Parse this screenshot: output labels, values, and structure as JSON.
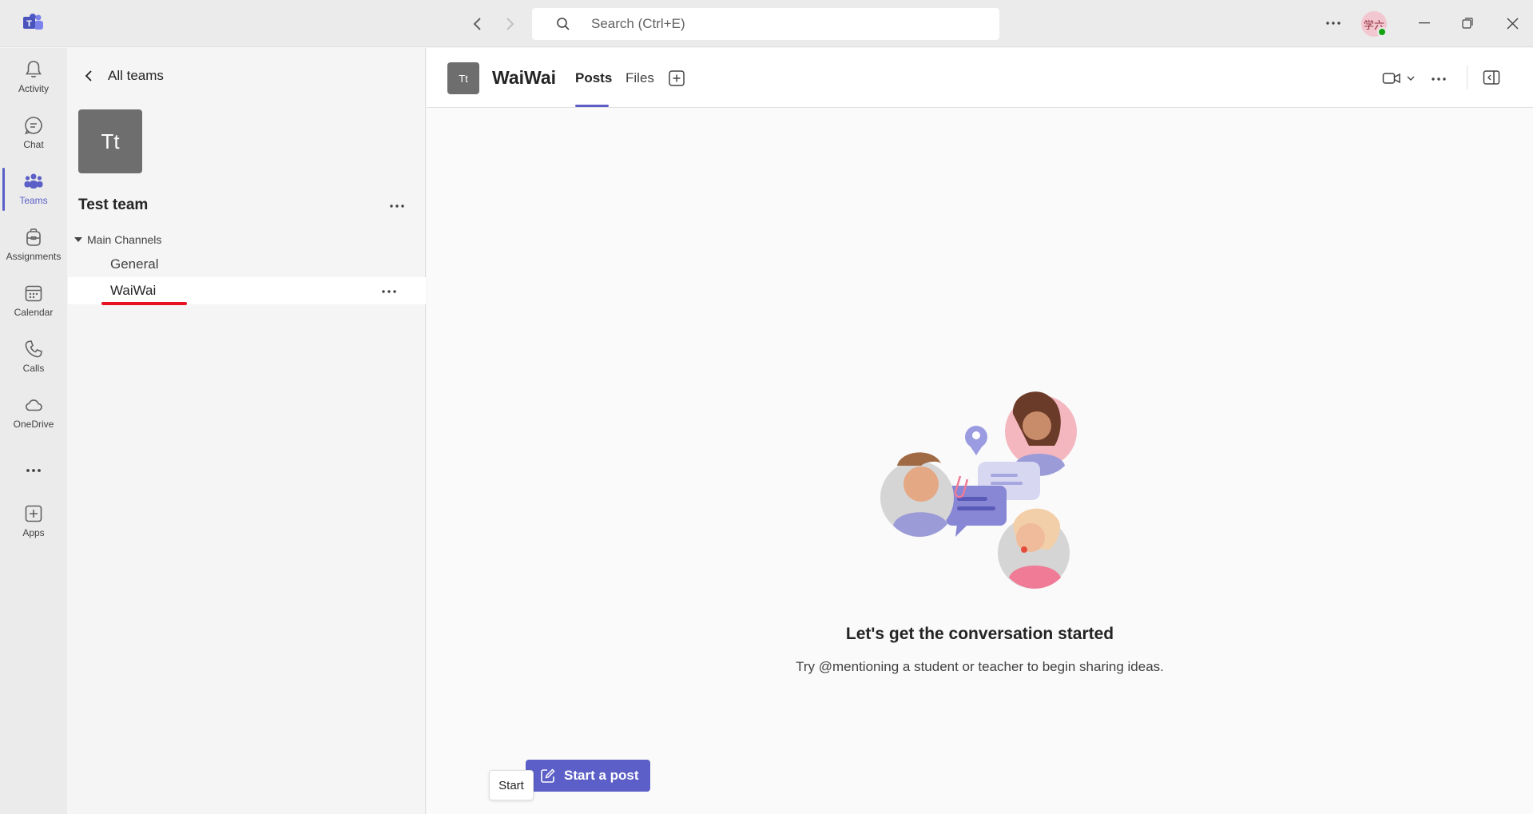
{
  "titlebar": {
    "search_placeholder": "Search (Ctrl+E)",
    "user_initials": "学六"
  },
  "rail": {
    "items": [
      {
        "label": "Activity",
        "icon": "bell-icon"
      },
      {
        "label": "Chat",
        "icon": "chat-icon"
      },
      {
        "label": "Teams",
        "icon": "teams-icon",
        "active": true
      },
      {
        "label": "Assignments",
        "icon": "backpack-icon"
      },
      {
        "label": "Calendar",
        "icon": "calendar-icon"
      },
      {
        "label": "Calls",
        "icon": "phone-icon"
      },
      {
        "label": "OneDrive",
        "icon": "cloud-icon"
      },
      {
        "label": "Apps",
        "icon": "add-app-icon"
      }
    ],
    "more_label": "•••"
  },
  "teampanel": {
    "back_label": "All teams",
    "team_initials": "Tt",
    "team_name": "Test team",
    "more": "•••",
    "section_label": "Main Channels",
    "channels": [
      {
        "name": "General"
      },
      {
        "name": "WaiWai",
        "selected": true
      }
    ]
  },
  "main": {
    "channel_initials": "Tt",
    "channel_title": "WaiWai",
    "tabs": [
      {
        "label": "Posts",
        "active": true
      },
      {
        "label": "Files"
      }
    ],
    "more": "•••",
    "empty_title": "Let's get the conversation started",
    "empty_subtitle": "Try @mentioning a student or teacher to begin sharing ideas.",
    "start_post_label": "Start a post",
    "tooltip": "Start"
  },
  "colors": {
    "accent": "#5b5fc7",
    "annotation_red": "#e81123",
    "presence_green": "#13a10e"
  }
}
